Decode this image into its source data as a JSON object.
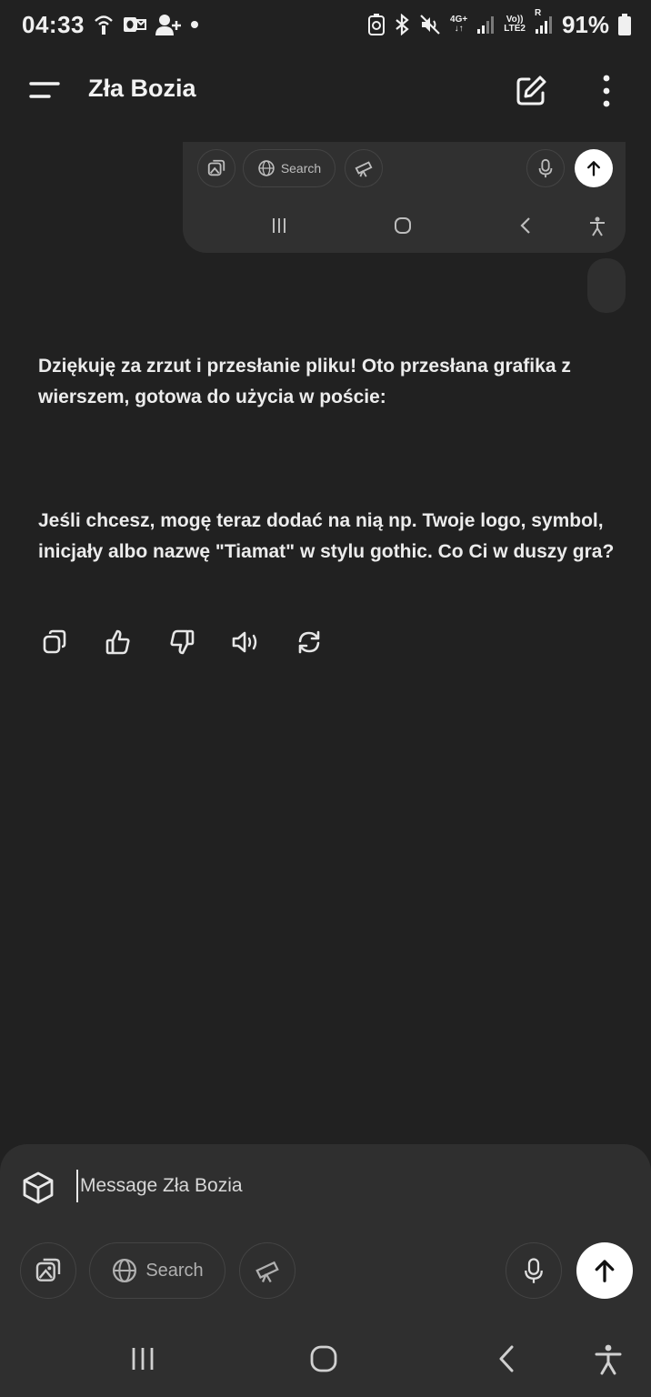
{
  "status_bar": {
    "time": "04:33",
    "battery": "91%",
    "network_4g": "4G+",
    "volte_top": "Vo))",
    "volte_bottom": "LTE2",
    "roaming": "R"
  },
  "header": {
    "title": "Zła Bozia"
  },
  "embedded_screenshot": {
    "search_label": "Search"
  },
  "assistant_message": {
    "paragraph_1": "Dziękuję za zrzut i przesłanie pliku! Oto przesłana grafika z wierszem, gotowa do użycia w poście:",
    "paragraph_2": "Jeśli chcesz, mogę teraz dodać na nią np. Twoje logo, symbol, inicjały albo nazwę \"Tiamat\" w stylu gothic. Co Ci w duszy gra?"
  },
  "composer": {
    "placeholder": "Message Zła Bozia",
    "search_label": "Search"
  },
  "colors": {
    "background": "#212121",
    "composer": "#2f2f2f",
    "text": "#ececec",
    "send_button": "#ffffff"
  },
  "icons": {
    "message_actions": [
      "copy-icon",
      "thumbs-up-icon",
      "thumbs-down-icon",
      "read-aloud-icon",
      "regenerate-icon"
    ]
  }
}
